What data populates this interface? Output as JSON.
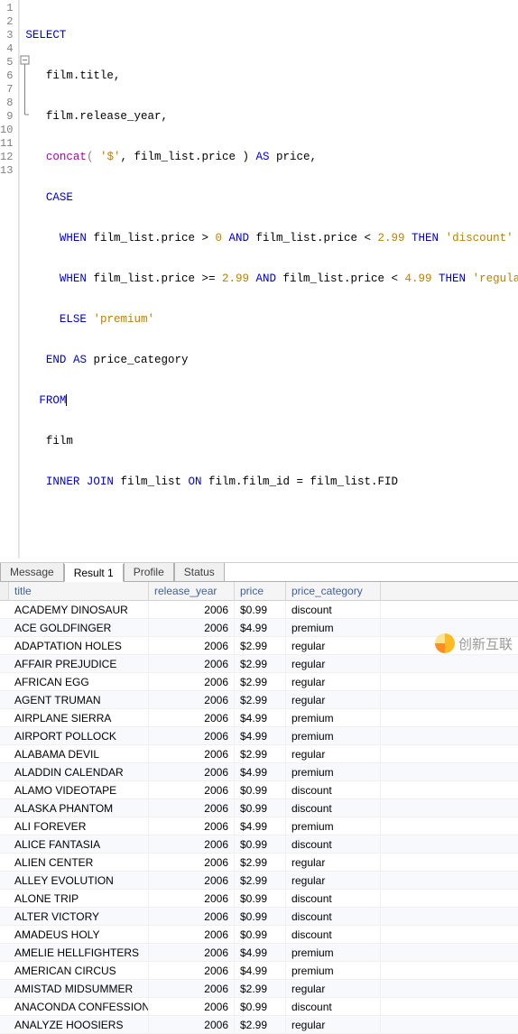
{
  "code": {
    "line1": {
      "select": "SELECT"
    },
    "line2": {
      "col": "film.title,"
    },
    "line3": {
      "col": "film.release_year,"
    },
    "line4": {
      "fn": "concat",
      "open": "( ",
      "str": "'$'",
      "mid": ", film_list.price ) ",
      "as": "AS",
      "alias": " price,"
    },
    "line5": {
      "case": "CASE"
    },
    "line6": {
      "when": "WHEN",
      "c1": " film_list.price > ",
      "n1": "0",
      "and": " AND ",
      "c2": "film_list.price < ",
      "n2": "2.99",
      "then": " THEN ",
      "str": "'discount'"
    },
    "line7": {
      "when": "WHEN",
      "c1": " film_list.price >= ",
      "n1": "2.99",
      "and": " AND ",
      "c2": "film_list.price < ",
      "n2": "4.99",
      "then": " THEN ",
      "str": "'regular'"
    },
    "line8": {
      "else": "ELSE",
      "str": " 'premium'"
    },
    "line9": {
      "end": "END",
      "as": " AS ",
      "alias": "price_category"
    },
    "line10": {
      "from": "FROM"
    },
    "line11": {
      "tbl": "film"
    },
    "line12": {
      "ij": "INNER JOIN",
      "t": " film_list ",
      "on": "ON",
      "cond": " film.film_id = film_list.FID"
    }
  },
  "tabs": [
    "Message",
    "Result 1",
    "Profile",
    "Status"
  ],
  "active_tab": 1,
  "columns": [
    "title",
    "release_year",
    "price",
    "price_category"
  ],
  "rows": [
    {
      "title": "ACADEMY DINOSAUR",
      "year": "2006",
      "price": "$0.99",
      "cat": "discount"
    },
    {
      "title": "ACE GOLDFINGER",
      "year": "2006",
      "price": "$4.99",
      "cat": "premium"
    },
    {
      "title": "ADAPTATION HOLES",
      "year": "2006",
      "price": "$2.99",
      "cat": "regular"
    },
    {
      "title": "AFFAIR PREJUDICE",
      "year": "2006",
      "price": "$2.99",
      "cat": "regular"
    },
    {
      "title": "AFRICAN EGG",
      "year": "2006",
      "price": "$2.99",
      "cat": "regular"
    },
    {
      "title": "AGENT TRUMAN",
      "year": "2006",
      "price": "$2.99",
      "cat": "regular"
    },
    {
      "title": "AIRPLANE SIERRA",
      "year": "2006",
      "price": "$4.99",
      "cat": "premium"
    },
    {
      "title": "AIRPORT POLLOCK",
      "year": "2006",
      "price": "$4.99",
      "cat": "premium"
    },
    {
      "title": "ALABAMA DEVIL",
      "year": "2006",
      "price": "$2.99",
      "cat": "regular"
    },
    {
      "title": "ALADDIN CALENDAR",
      "year": "2006",
      "price": "$4.99",
      "cat": "premium"
    },
    {
      "title": "ALAMO VIDEOTAPE",
      "year": "2006",
      "price": "$0.99",
      "cat": "discount"
    },
    {
      "title": "ALASKA PHANTOM",
      "year": "2006",
      "price": "$0.99",
      "cat": "discount"
    },
    {
      "title": "ALI FOREVER",
      "year": "2006",
      "price": "$4.99",
      "cat": "premium"
    },
    {
      "title": "ALICE FANTASIA",
      "year": "2006",
      "price": "$0.99",
      "cat": "discount"
    },
    {
      "title": "ALIEN CENTER",
      "year": "2006",
      "price": "$2.99",
      "cat": "regular"
    },
    {
      "title": "ALLEY EVOLUTION",
      "year": "2006",
      "price": "$2.99",
      "cat": "regular"
    },
    {
      "title": "ALONE TRIP",
      "year": "2006",
      "price": "$0.99",
      "cat": "discount"
    },
    {
      "title": "ALTER VICTORY",
      "year": "2006",
      "price": "$0.99",
      "cat": "discount"
    },
    {
      "title": "AMADEUS HOLY",
      "year": "2006",
      "price": "$0.99",
      "cat": "discount"
    },
    {
      "title": "AMELIE HELLFIGHTERS",
      "year": "2006",
      "price": "$4.99",
      "cat": "premium"
    },
    {
      "title": "AMERICAN CIRCUS",
      "year": "2006",
      "price": "$4.99",
      "cat": "premium"
    },
    {
      "title": "AMISTAD MIDSUMMER",
      "year": "2006",
      "price": "$2.99",
      "cat": "regular"
    },
    {
      "title": "ANACONDA CONFESSIONS",
      "year": "2006",
      "price": "$0.99",
      "cat": "discount"
    },
    {
      "title": "ANALYZE HOOSIERS",
      "year": "2006",
      "price": "$2.99",
      "cat": "regular"
    }
  ],
  "watermark": "创新互联"
}
